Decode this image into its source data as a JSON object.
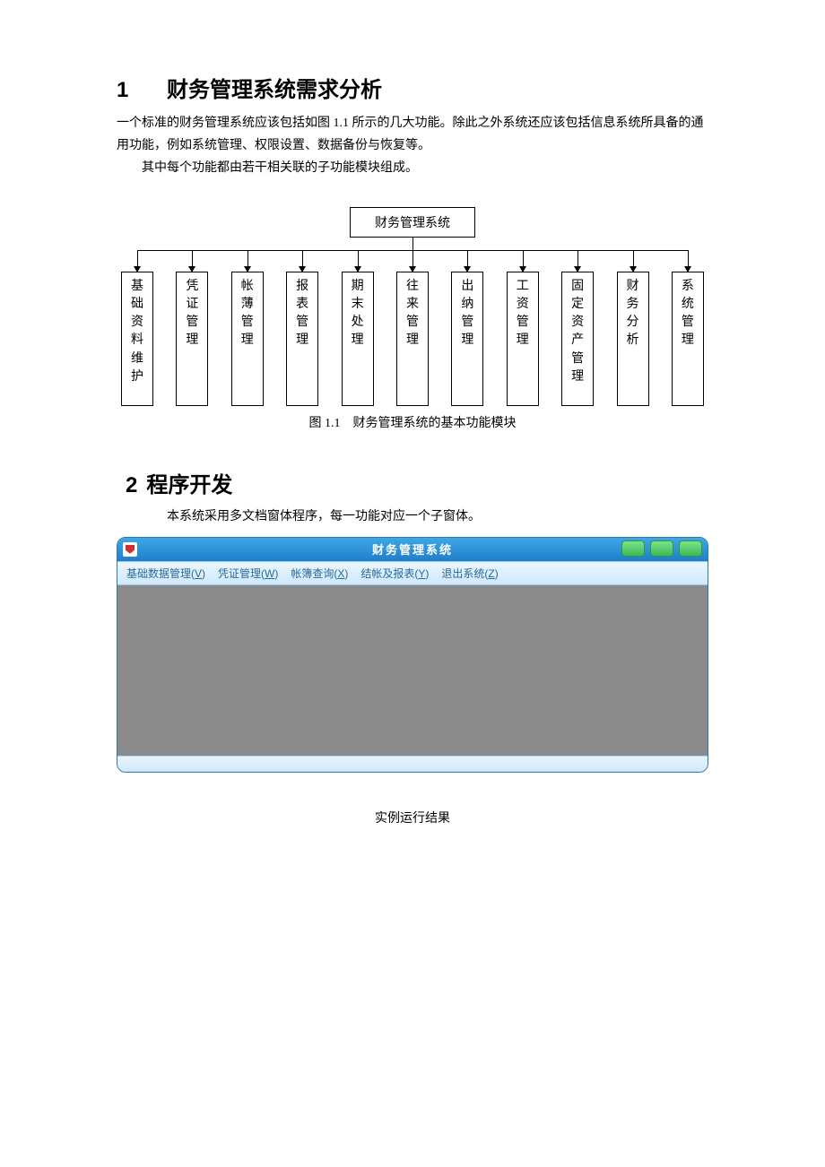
{
  "section1": {
    "number": "1",
    "title": "财务管理系统需求分析",
    "para1": "一个标准的财务管理系统应该包括如图 1.1 所示的几大功能。除此之外系统还应该包括信息系统所具备的通用功能，例如系统管理、权限设置、数据备份与恢复等。",
    "para2": "其中每个功能都由若干相关联的子功能模块组成。"
  },
  "orgchart": {
    "root": "财务管理系统",
    "children": [
      "基础资料维护",
      "凭证管理",
      "帐薄管理",
      "报表管理",
      "期末处理",
      "往来管理",
      "出纳管理",
      "工资管理",
      "固定资产管理",
      "财务分析",
      "系统管理"
    ],
    "caption": "图 1.1　财务管理系统的基本功能模块"
  },
  "section2": {
    "number": "2",
    "title": "程序开发",
    "para": "本系统采用多文档窗体程序，每一功能对应一个子窗体。"
  },
  "app": {
    "title": "财务管理系统",
    "menus": [
      {
        "label": "基础数据管理",
        "accel": "V"
      },
      {
        "label": "凭证管理",
        "accel": "W"
      },
      {
        "label": "帐簿查询",
        "accel": "X"
      },
      {
        "label": "结帐及报表",
        "accel": "Y"
      },
      {
        "label": "退出系统",
        "accel": "Z"
      }
    ],
    "run_caption": "实例运行结果"
  }
}
